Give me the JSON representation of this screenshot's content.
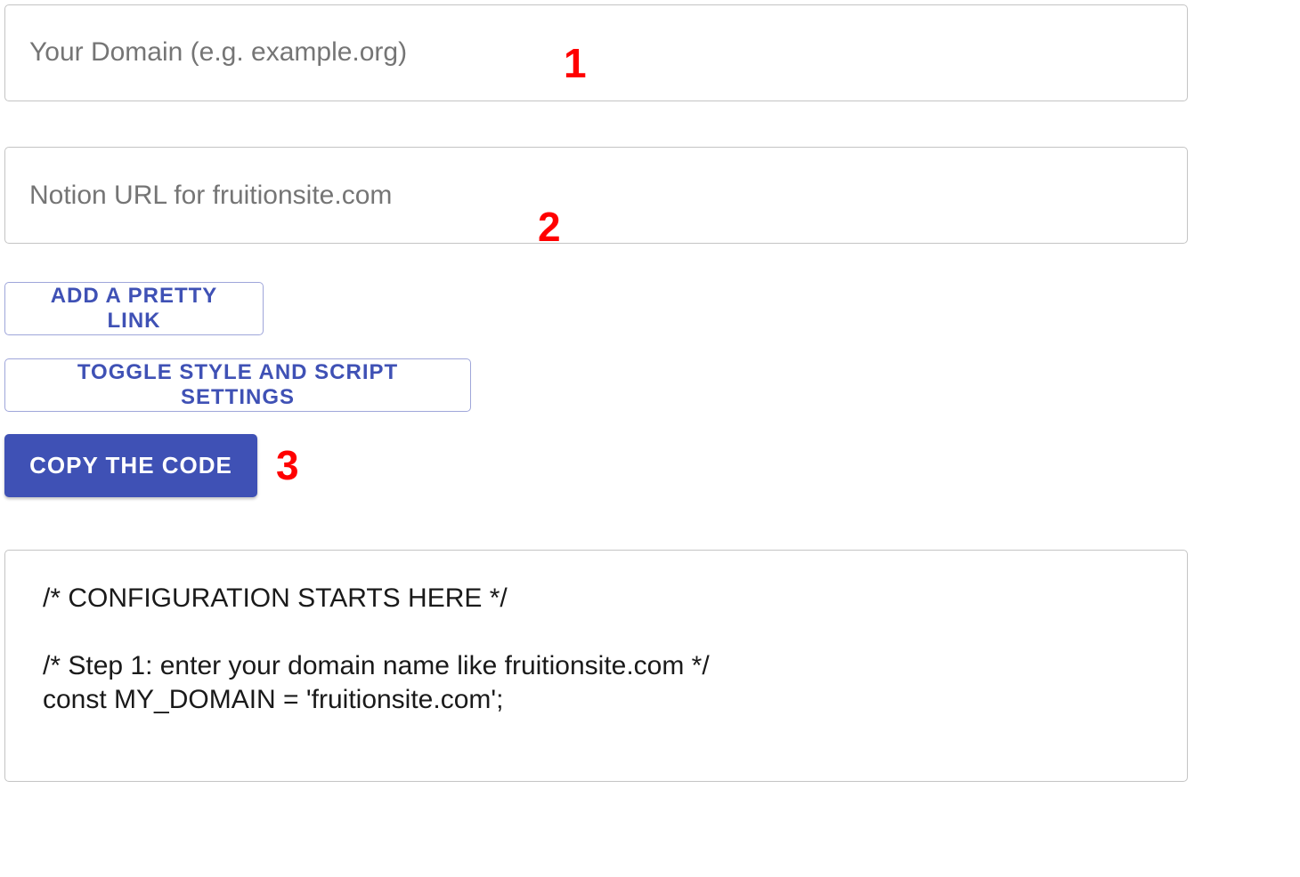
{
  "domain_input": {
    "value": "",
    "placeholder": "Your Domain (e.g. example.org)"
  },
  "notion_input": {
    "value": "",
    "placeholder": "Notion URL for fruitionsite.com"
  },
  "annotations": {
    "one": "1",
    "two": "2",
    "three": "3"
  },
  "buttons": {
    "add_pretty_link": "ADD A PRETTY LINK",
    "toggle_settings": "TOGGLE STYLE AND SCRIPT SETTINGS",
    "copy_code": "COPY THE CODE"
  },
  "code": {
    "text": "/* CONFIGURATION STARTS HERE */\n\n/* Step 1: enter your domain name like fruitionsite.com */\nconst MY_DOMAIN = 'fruitionsite.com';"
  },
  "colors": {
    "primary": "#3f51b5",
    "annotation": "#ff0000",
    "border": "#c4c4c4"
  }
}
